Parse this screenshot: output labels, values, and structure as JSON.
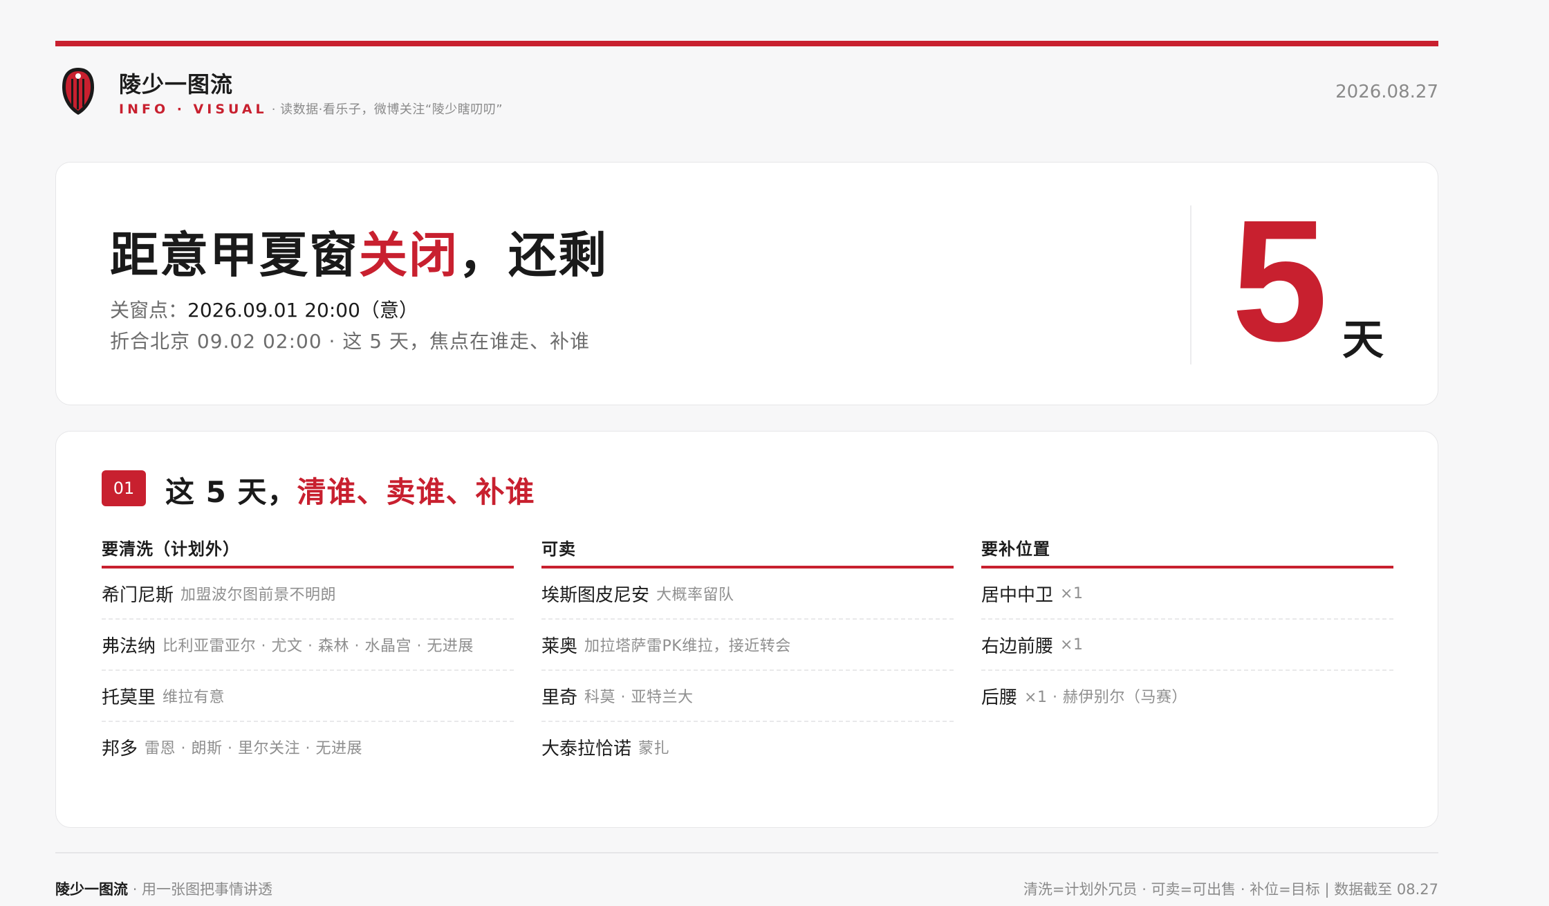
{
  "header": {
    "title": "陵少一图流",
    "tag": "INFO · VISUAL",
    "subtitle": "· 读数据·看乐子，微博关注“陵少瞎叨叨”",
    "date": "2026.08.27",
    "logo_icon": "ac-milan-crest-icon"
  },
  "hero": {
    "title_prefix": "距意甲夏窗",
    "title_highlight": "关闭",
    "title_suffix": "，还剩",
    "close_label": "关窗点：",
    "close_value": "2026.09.01 20:00（意）",
    "beijing_line": "折合北京 09.02 02:00 · 这 5 天，焦点在谁走、补谁",
    "days_number": "5",
    "days_unit": "天"
  },
  "section": {
    "badge": "01",
    "title_prefix": "这 5 天，",
    "title_highlight": "清谁、卖谁、补谁",
    "columns": [
      {
        "header": "要清洗（计划外）",
        "rows": [
          {
            "name": "希门尼斯",
            "note": "加盟波尔图前景不明朗"
          },
          {
            "name": "弗法纳",
            "note": "比利亚雷亚尔 · 尤文 · 森林 · 水晶宫 · 无进展"
          },
          {
            "name": "托莫里",
            "note": "维拉有意"
          },
          {
            "name": "邦多",
            "note": "雷恩 · 朗斯 · 里尔关注 · 无进展"
          }
        ]
      },
      {
        "header": "可卖",
        "rows": [
          {
            "name": "埃斯图皮尼安",
            "note": "大概率留队"
          },
          {
            "name": "莱奥",
            "note": "加拉塔萨雷PK维拉，接近转会"
          },
          {
            "name": "里奇",
            "note": "科莫 · 亚特兰大"
          },
          {
            "name": "大泰拉恰诺",
            "note": "蒙扎"
          }
        ]
      },
      {
        "header": "要补位置",
        "rows": [
          {
            "name": "居中中卫",
            "note": "×1"
          },
          {
            "name": "右边前腰",
            "note": "×1"
          },
          {
            "name": "后腰",
            "note": "×1 · 赫伊别尔（马赛）"
          }
        ]
      }
    ]
  },
  "footer": {
    "brand": "陵少一图流",
    "slogan": "· 用一张图把事情讲透",
    "legend": "清洗=计划外冗员 · 可卖=可出售 · 补位=目标 | 数据截至 08.27"
  },
  "colors": {
    "accent": "#c8202f",
    "text": "#1c1c1c",
    "muted": "#8a8a8a",
    "background": "#f7f7f8"
  }
}
